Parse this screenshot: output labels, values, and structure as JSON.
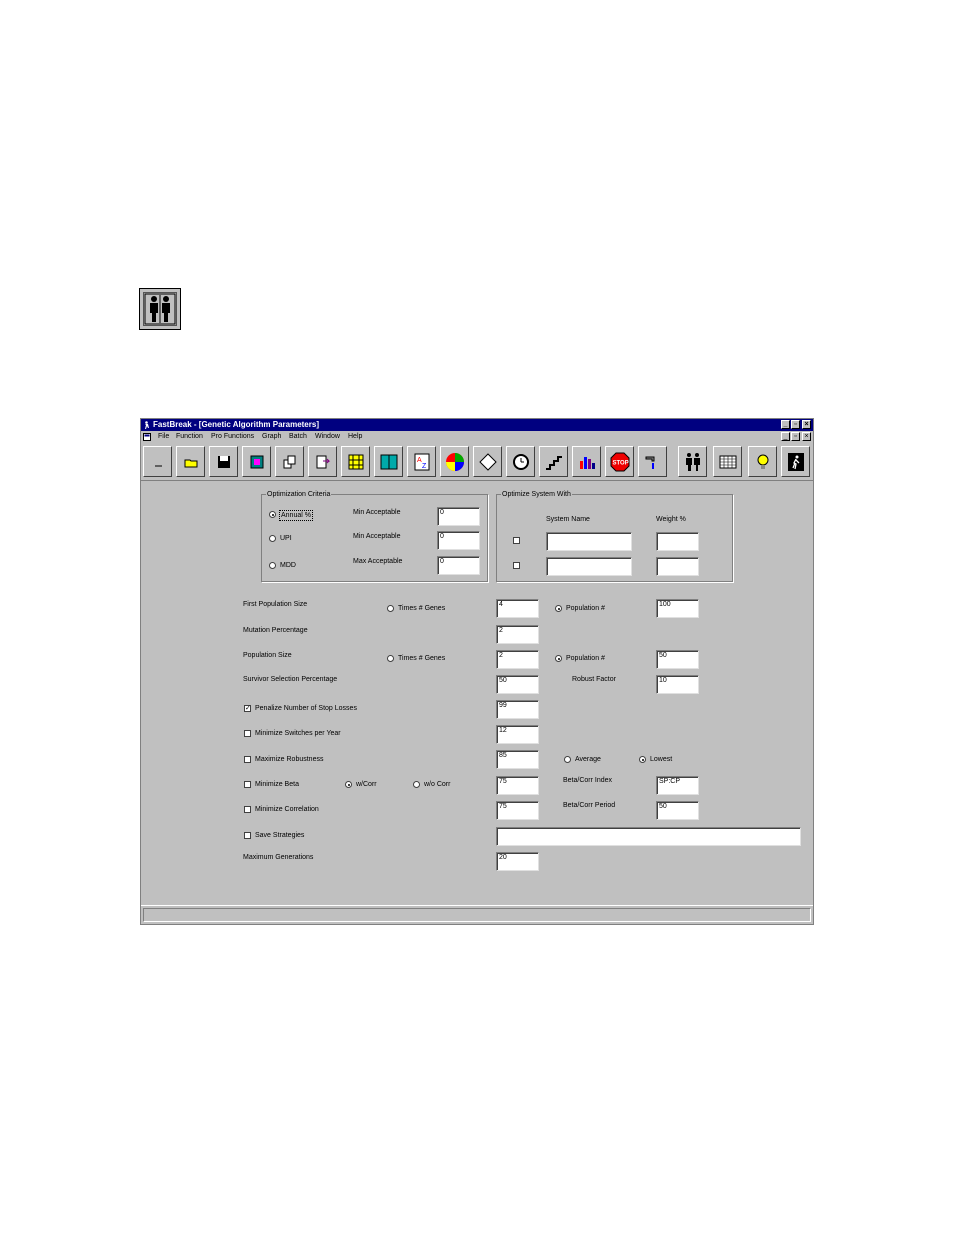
{
  "window": {
    "title": "FastBreak - [Genetic Algorithm Parameters]",
    "buttons": {
      "min": "_",
      "restore": "▫",
      "close": "×"
    }
  },
  "menu": [
    "File",
    "Function",
    "Pro Functions",
    "Graph",
    "Batch",
    "Window",
    "Help"
  ],
  "toolbar_icons": [
    "new-icon",
    "open-icon",
    "save-icon",
    "print-icon",
    "copy-icon",
    "export-icon",
    "genes-icon",
    "book-icon",
    "sort-az-icon",
    "color-wheel-icon",
    "diamond-icon",
    "watch-icon",
    "chart-steps-icon",
    "bar-chart-icon",
    "stop-icon",
    "water-tap-icon",
    "people-icon",
    "grid-icon",
    "bulb-icon",
    "exit-icon"
  ],
  "stop_label": "STOP",
  "optimization_criteria": {
    "group_label": "Optimization Criteria",
    "rows": [
      {
        "option": "Annual %",
        "selected": true,
        "limit_label": "Min Acceptable",
        "value": "0"
      },
      {
        "option": "UPI",
        "selected": false,
        "limit_label": "Min Acceptable",
        "value": "0"
      },
      {
        "option": "MDD",
        "selected": false,
        "limit_label": "Max Acceptable",
        "value": "0"
      }
    ]
  },
  "optimize_system": {
    "group_label": "Optimize System With",
    "col_system": "System Name",
    "col_weight": "Weight %",
    "rows": [
      {
        "checked": false,
        "system": "",
        "weight": ""
      },
      {
        "checked": false,
        "system": "",
        "weight": ""
      }
    ]
  },
  "params": {
    "first_population_size": {
      "label": "First Population Size",
      "times_genes": "Times # Genes",
      "value": "4",
      "population_label": "Population #",
      "population": "100"
    },
    "mutation_percentage": {
      "label": "Mutation Percentage",
      "value": "2"
    },
    "population_size": {
      "label": "Population Size",
      "times_genes": "Times # Genes",
      "value": "2",
      "population_label": "Population #",
      "population": "50"
    },
    "survivor_selection": {
      "label": "Survivor Selection Percentage",
      "value": "50",
      "robust_label": "Robust Factor",
      "robust": "10"
    },
    "penalize_stop_losses": {
      "label": "Penalize Number of Stop Losses",
      "checked": true,
      "value": "99"
    },
    "minimize_switches": {
      "label": "Minimize Switches per Year",
      "checked": false,
      "value": "12"
    },
    "maximize_robustness": {
      "label": "Maximize Robustness",
      "checked": false,
      "value": "85",
      "average_label": "Average",
      "lowest_label": "Lowest"
    },
    "minimize_beta": {
      "label": "Minimize Beta",
      "checked": false,
      "w_corr": "w/Corr",
      "wo_corr": "w/o Corr",
      "value": "75",
      "index_label": "Beta/Corr Index",
      "index": "SP:CP"
    },
    "minimize_correlation": {
      "label": "Minimize Correlation",
      "checked": false,
      "value": "75",
      "period_label": "Beta/Corr Period",
      "period": "50"
    },
    "save_strategies": {
      "label": "Save Strategies",
      "checked": false,
      "value": ""
    },
    "maximum_generations": {
      "label": "Maximum Generations",
      "value": "20"
    }
  }
}
